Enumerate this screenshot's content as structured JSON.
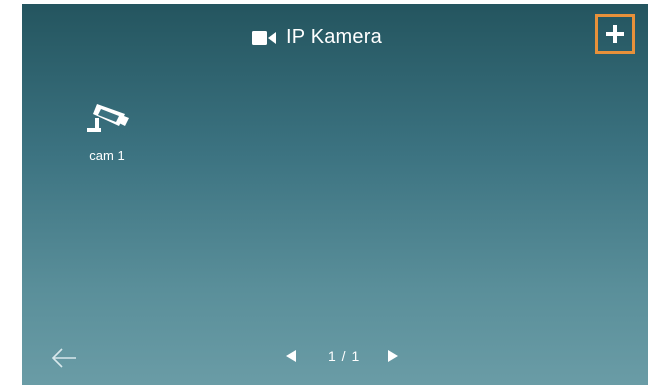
{
  "header": {
    "title": "IP Kamera",
    "title_icon": "video-camera-icon",
    "add_icon": "plus-icon",
    "add_highlight_color": "#e8913a"
  },
  "cameras": [
    {
      "label": "cam 1",
      "icon": "cctv-camera-icon"
    }
  ],
  "footer": {
    "back_icon": "arrow-left-icon",
    "prev_icon": "triangle-left-icon",
    "next_icon": "triangle-right-icon",
    "page_indicator": "1 / 1"
  },
  "colors": {
    "background_top": "#24555f",
    "background_bottom": "#6a9ca6",
    "text": "#ffffff"
  }
}
